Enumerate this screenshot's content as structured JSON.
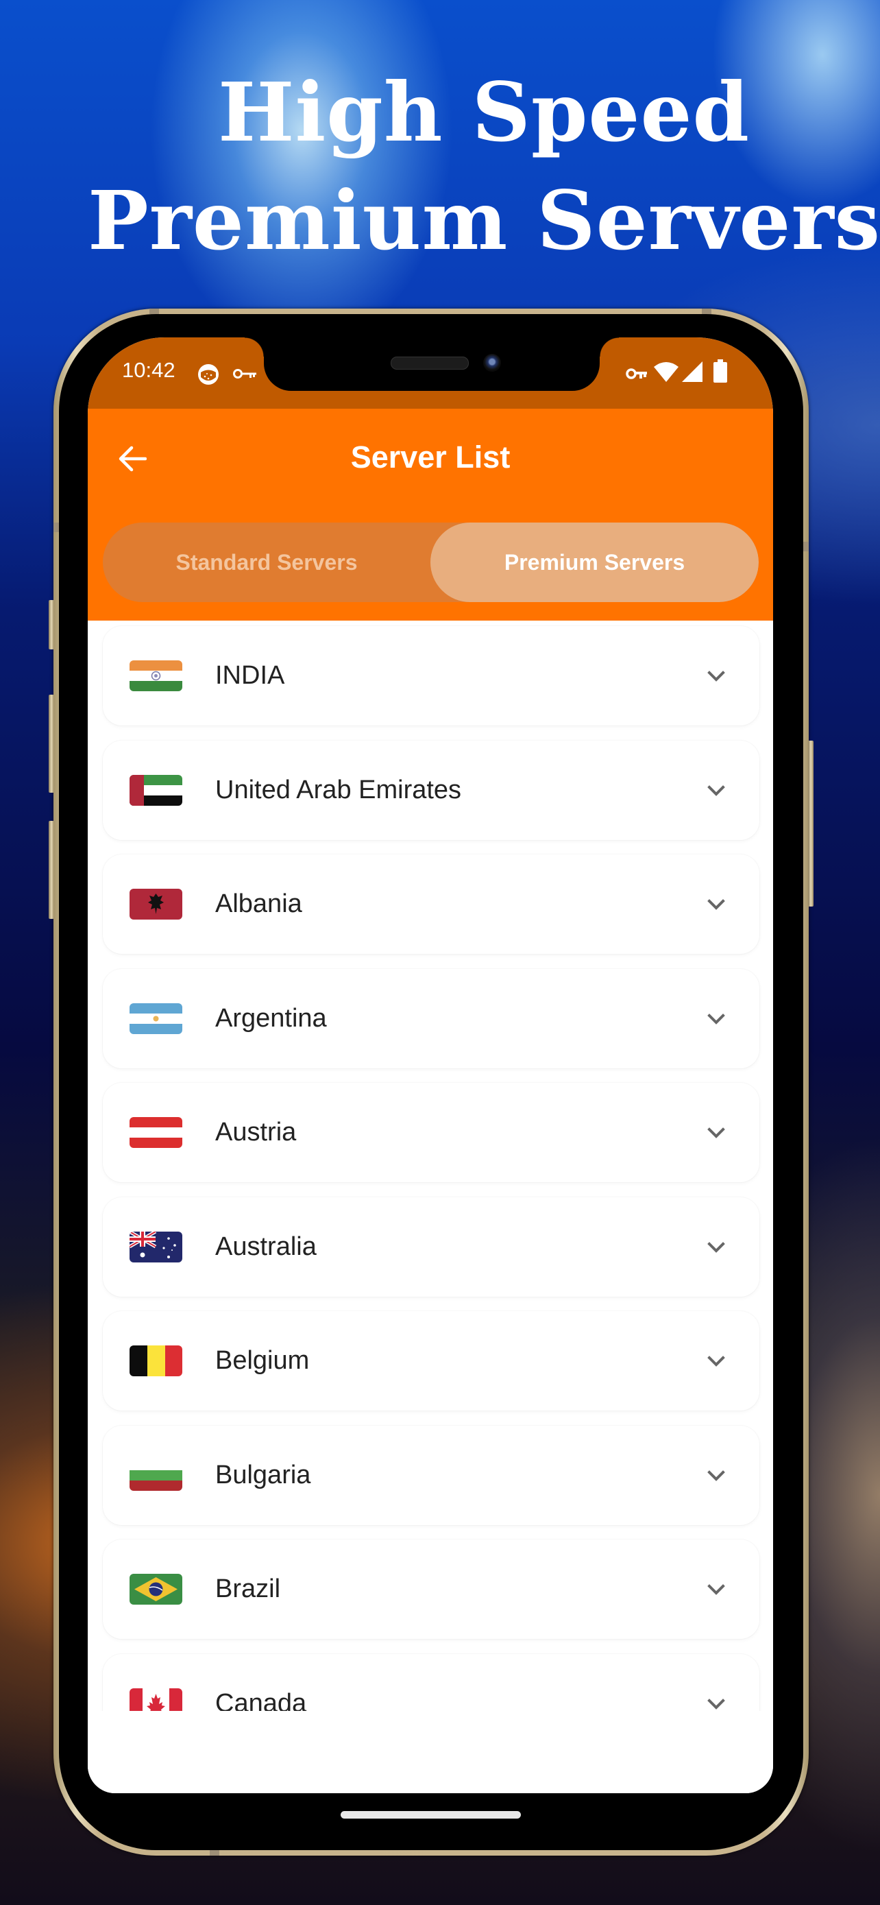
{
  "promo": {
    "headline_line1": "High Speed",
    "headline_line2": "Premium Servers"
  },
  "status_bar": {
    "time": "10:42",
    "left_icons": [
      "app-notification-icon",
      "vpn-key-icon"
    ],
    "right_icons": [
      "vpn-key-icon",
      "wifi-icon",
      "cellular-signal-icon",
      "battery-icon"
    ]
  },
  "app_bar": {
    "back_icon": "arrow-left-icon",
    "title": "Server List"
  },
  "tabs": {
    "items": [
      {
        "label": "Standard Servers",
        "selected": false
      },
      {
        "label": "Premium Servers",
        "selected": true
      }
    ]
  },
  "servers": [
    {
      "name": "INDIA",
      "flag": "india"
    },
    {
      "name": "United Arab Emirates",
      "flag": "uae"
    },
    {
      "name": "Albania",
      "flag": "albania"
    },
    {
      "name": "Argentina",
      "flag": "argentina"
    },
    {
      "name": "Austria",
      "flag": "austria"
    },
    {
      "name": "Australia",
      "flag": "australia"
    },
    {
      "name": "Belgium",
      "flag": "belgium"
    },
    {
      "name": "Bulgaria",
      "flag": "bulgaria"
    },
    {
      "name": "Brazil",
      "flag": "brazil"
    },
    {
      "name": "Canada",
      "flag": "canada"
    }
  ],
  "colors": {
    "status_bar": "#C05A00",
    "app_bar": "#FF7300",
    "tab_track": "#E07C30",
    "tab_selected": "#E8AE7E",
    "tab_unselected_text": "#F4C59E",
    "list_text": "#222222",
    "chevron": "#666666"
  }
}
